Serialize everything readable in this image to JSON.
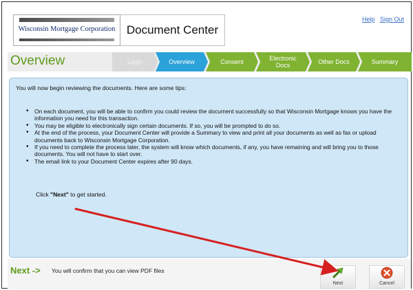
{
  "header": {
    "logo_text": "Wisconsin Mortgage Corporation",
    "title": "Document Center",
    "links": {
      "help": "Help",
      "signout": "Sign Out"
    }
  },
  "nav": {
    "page_title": "Overview",
    "steps": [
      {
        "label": "Login",
        "state": "disabled"
      },
      {
        "label": "Overview",
        "state": "active"
      },
      {
        "label": "Consent",
        "state": "upcoming"
      },
      {
        "label_line1": "Electronic",
        "label_line2": "Docs",
        "state": "upcoming"
      },
      {
        "label": "Other Docs",
        "state": "upcoming"
      },
      {
        "label": "Summary",
        "state": "upcoming"
      }
    ]
  },
  "content": {
    "intro": "You will now begin reviewing the documents. Here are some tips:",
    "tips": [
      "On each document, you will be able to confirm you could review the document successfully so that Wisconsin Mortgage knows you have the information you need for this transaction.",
      "You may be eligible to electronically sign certain documents. If so, you will be prompted to do so.",
      "At the end of the process, your Document Center will provide a Summary to view and print all your documents as well as fax or upload documents back to Wisconsin Mortgage Corporation.",
      "If you need to complete the process later, the system will know which documents, if any, you have remaining and will bring you to those documents. You will not have to start over.",
      "The email link to your Document Center expires after 90 days."
    ],
    "start_prefix": "Click ",
    "start_bold": "\"Next\"",
    "start_suffix": " to get started."
  },
  "footer": {
    "next_arrow": "Next ->",
    "next_desc": "You will confirm that you can view PDF files",
    "next_button": "Next",
    "cancel_button": "Cancel"
  },
  "colors": {
    "brand_green": "#5e9a1e",
    "step_green": "#7fb331",
    "active_blue": "#2ba2da",
    "panel_blue": "#d0e7f7",
    "annotation_red": "#d62020"
  },
  "icons": {
    "next": "green-arrow-icon",
    "cancel": "red-x-circle-icon"
  }
}
